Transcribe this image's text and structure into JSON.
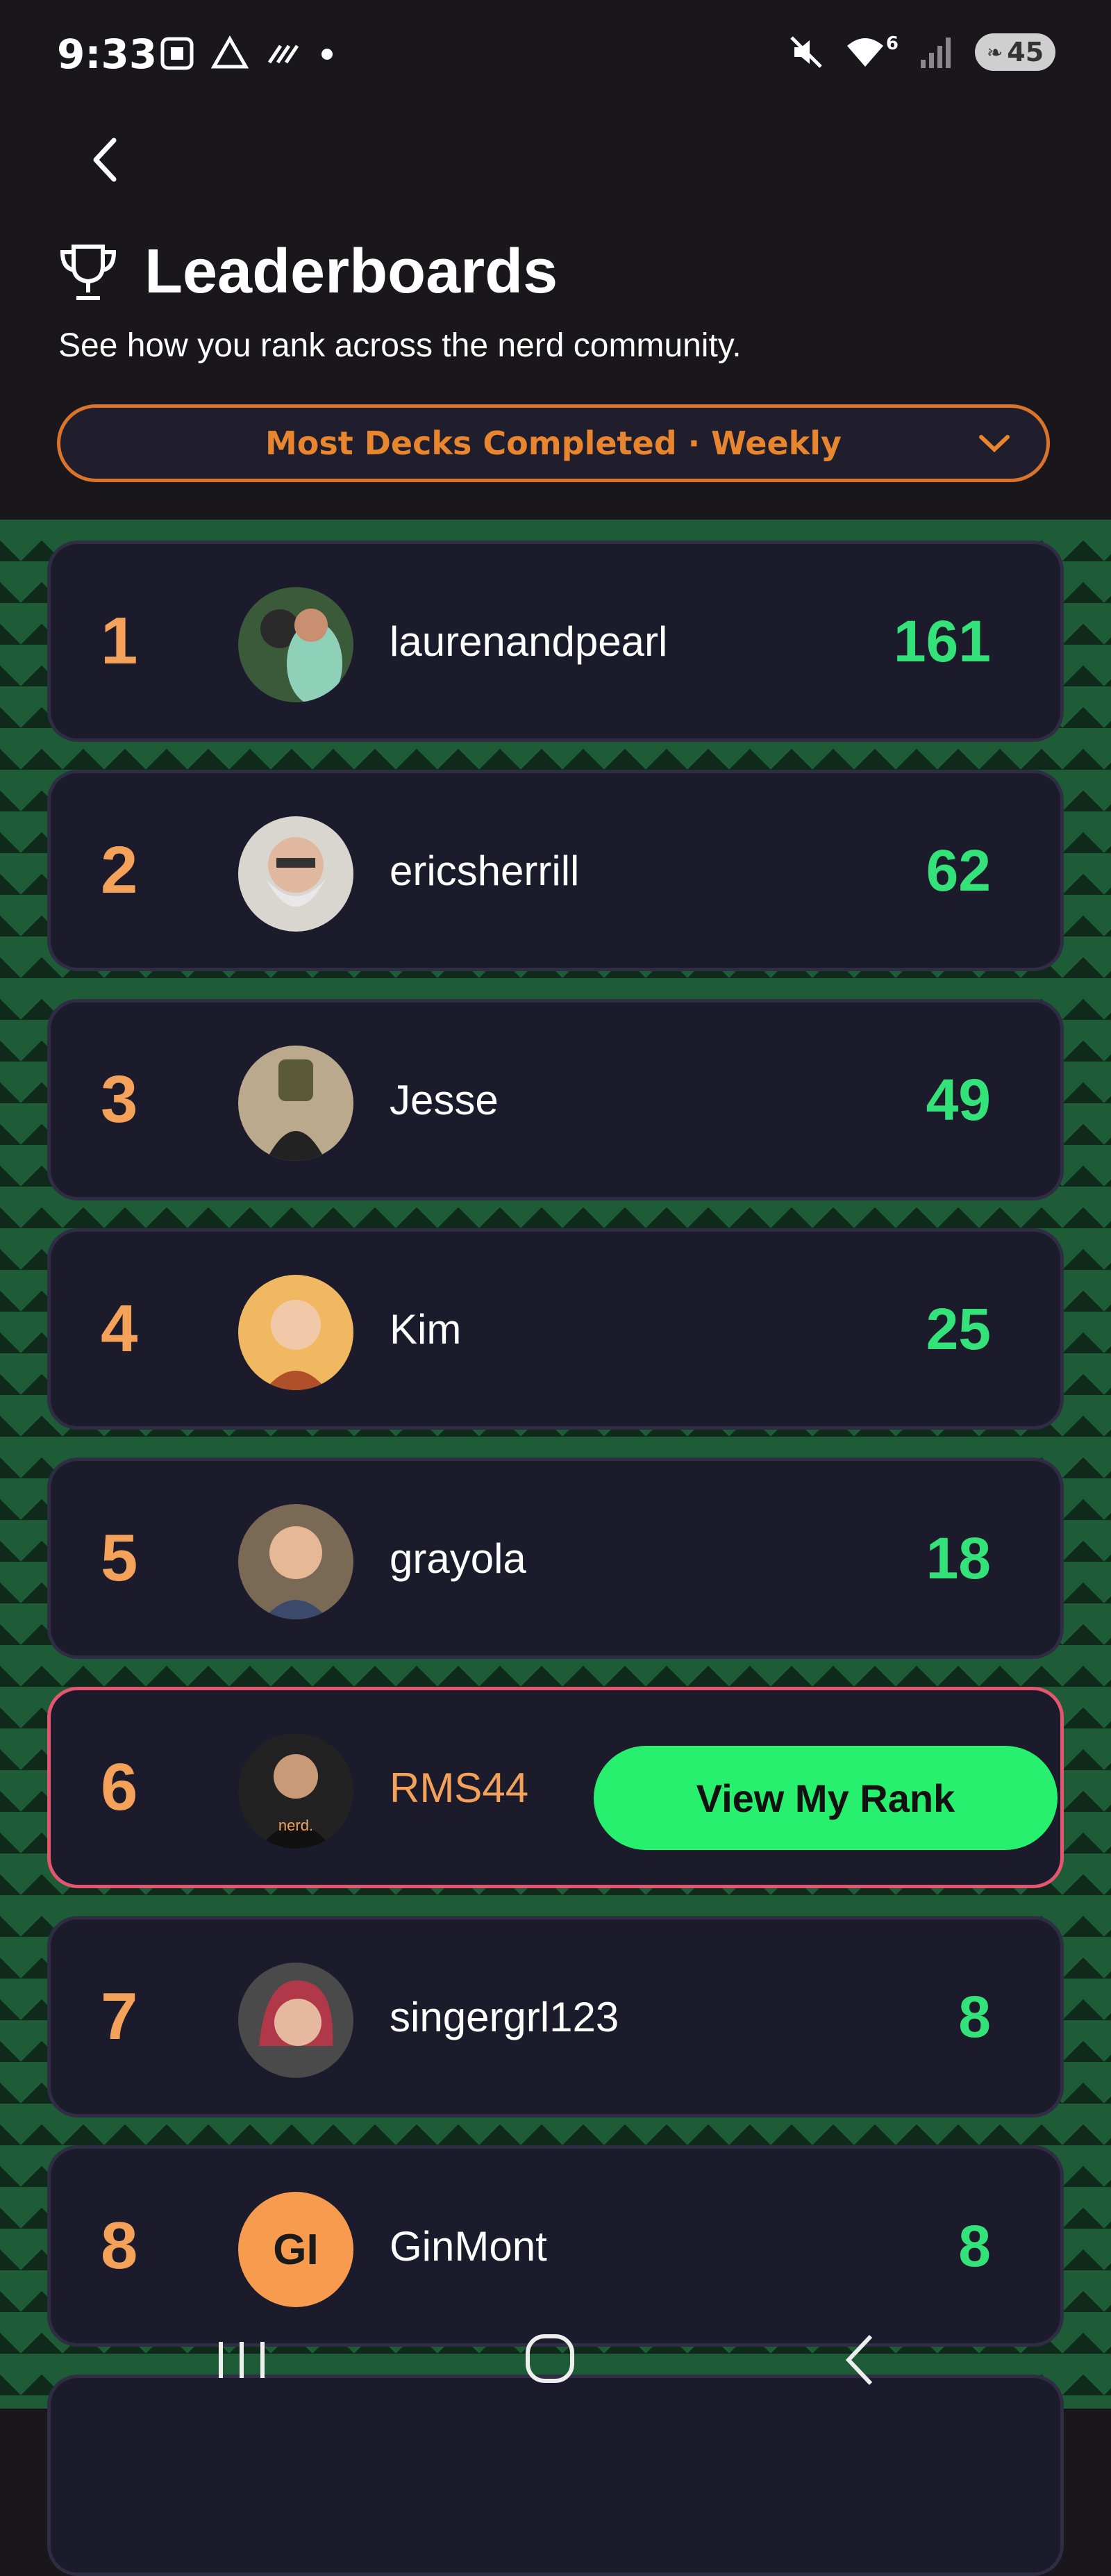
{
  "status_bar": {
    "time": "9:33",
    "signal_label": "6",
    "battery": "45"
  },
  "header": {
    "title": "Leaderboards",
    "subtitle": "See how you rank across the nerd community.",
    "filter_label": "Most Decks Completed · Weekly"
  },
  "leaderboard": [
    {
      "rank": "1",
      "name": "laurenandpearl",
      "score": "161"
    },
    {
      "rank": "2",
      "name": "ericsherrill",
      "score": "62"
    },
    {
      "rank": "3",
      "name": "Jesse",
      "score": "49"
    },
    {
      "rank": "4",
      "name": "Kim",
      "score": "25"
    },
    {
      "rank": "5",
      "name": "grayola",
      "score": "18"
    },
    {
      "rank": "6",
      "name": "RMS44",
      "score": "",
      "is_me": true
    },
    {
      "rank": "7",
      "name": "singergrl123",
      "score": "8"
    },
    {
      "rank": "8",
      "name": "GinMont",
      "score": "8",
      "initials": "GI"
    }
  ],
  "view_rank_label": "View My Rank",
  "avatar_shirt_text": "nerd.",
  "colors": {
    "accent_orange": "#f4a15a",
    "score_green": "#34e27a",
    "button_green": "#27f06f",
    "highlight_border": "#e4556f"
  }
}
